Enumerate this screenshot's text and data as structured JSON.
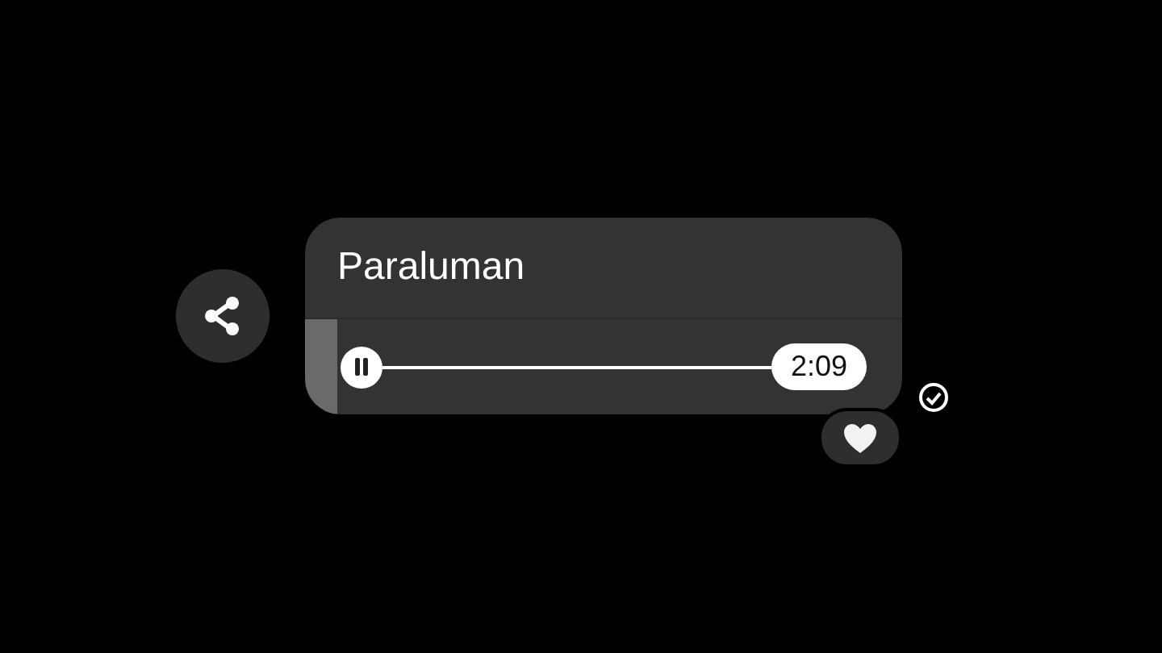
{
  "message": {
    "title": "Paraluman",
    "playing": true,
    "duration": "2:09",
    "delivered": true,
    "liked": true
  }
}
